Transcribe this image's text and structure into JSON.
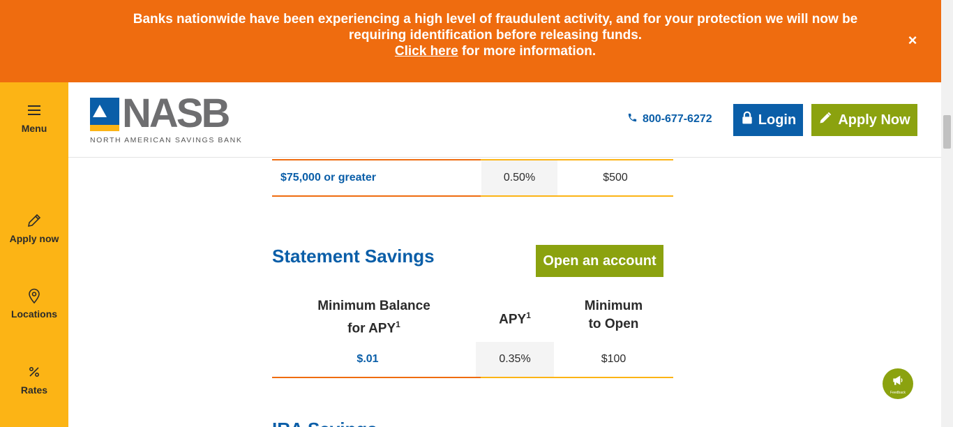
{
  "alert": {
    "line1": "Banks nationwide have been experiencing a high level of fraudulent activity, and for your protection we will now be requiring identification before releasing funds.",
    "link_text": "Click here",
    "line2_rest": " for more information.",
    "close_symbol": "×"
  },
  "rail": {
    "menu_label": "Menu",
    "apply_label": "Apply now",
    "locations_label": "Locations",
    "rates_label": "Rates"
  },
  "header": {
    "logo_word": "NASB",
    "logo_sub": "NORTH AMERICAN SAVINGS BANK",
    "phone": "800-677-6272",
    "login_label": "Login",
    "apply_label": "Apply Now"
  },
  "prev_table": {
    "row": {
      "balance": "$75,000 or greater",
      "apy": "0.50%",
      "min_open": "$500"
    }
  },
  "statement_savings": {
    "title": "Statement Savings",
    "open_label": "Open an account",
    "col1_line1": "Minimum Balance",
    "col1_line2": "for APY",
    "col1_sup": "1",
    "col2": "APY",
    "col2_sup": "1",
    "col3_line1": "Minimum",
    "col3_line2": "to Open",
    "row": {
      "balance": "$.01",
      "apy": "0.35%",
      "min_open": "$100"
    }
  },
  "next_section": {
    "title_partial": "IRA Savings"
  },
  "feedback": {
    "label": "Feedback"
  },
  "colors": {
    "orange": "#ef6c0f",
    "yellow": "#fcb415",
    "blue": "#0a5ea8",
    "green": "#8ba20f"
  }
}
